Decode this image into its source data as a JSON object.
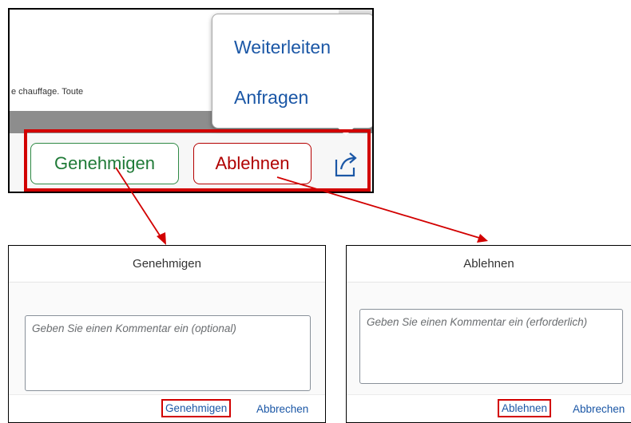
{
  "top": {
    "document_snippet": "e chauffage. Toute",
    "popover": {
      "forward_label": "Weiterleiten",
      "inquire_label": "Anfragen"
    },
    "footer": {
      "approve_label": "Genehmigen",
      "reject_label": "Ablehnen",
      "share_icon": "share-icon"
    }
  },
  "approve_dialog": {
    "title": "Genehmigen",
    "comment_placeholder": "Geben Sie einen Kommentar ein (optional)",
    "confirm_label": "Genehmigen",
    "cancel_label": "Abbrechen"
  },
  "reject_dialog": {
    "title": "Ablehnen",
    "comment_placeholder": "Geben Sie einen Kommentar ein (erforderlich)",
    "confirm_label": "Ablehnen",
    "cancel_label": "Abbrechen"
  },
  "colors": {
    "highlight": "#d20000",
    "approve": "#1f7a37",
    "reject": "#b00000",
    "link": "#1b57a6"
  }
}
